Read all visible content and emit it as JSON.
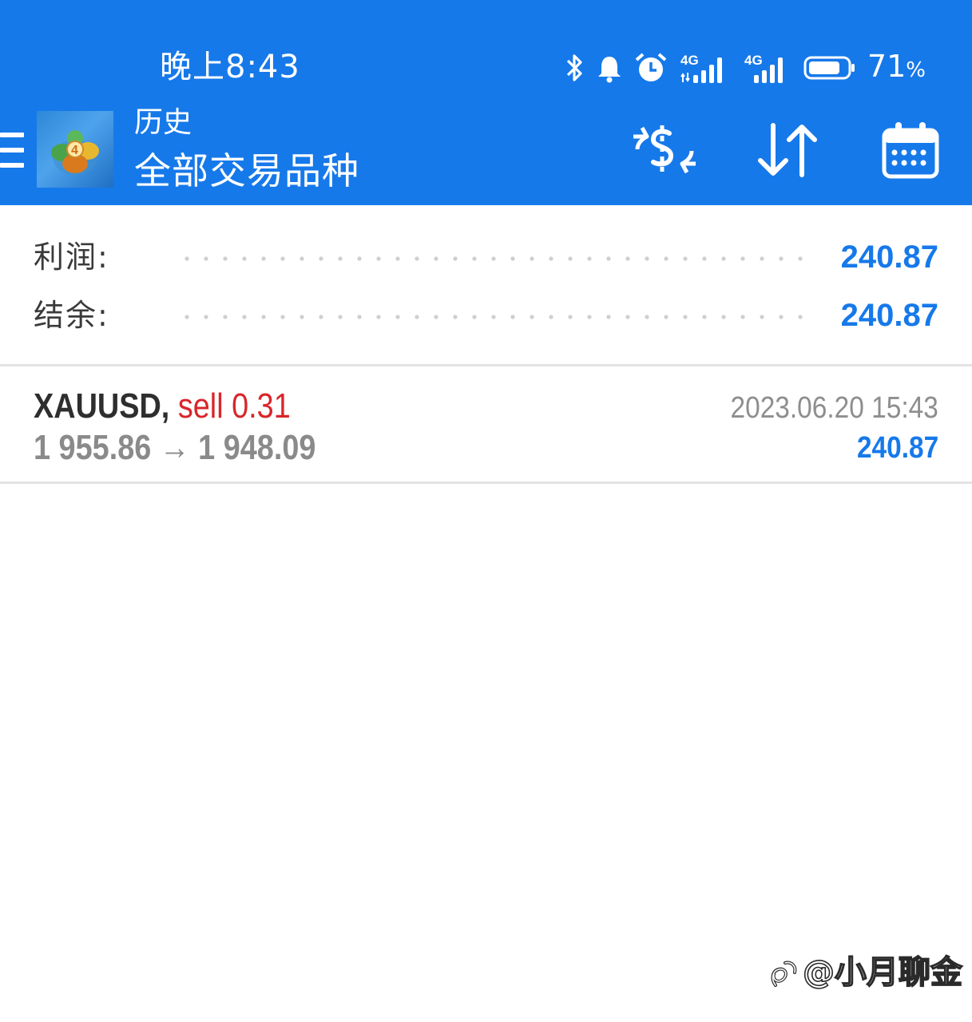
{
  "status_bar": {
    "time": "晚上8:43",
    "network_1": "4G",
    "network_2": "4G",
    "battery_percent": "71",
    "battery_unit": "%"
  },
  "header": {
    "title_small": "历史",
    "title_large": "全部交易品种",
    "logo_badge": "4"
  },
  "summary": {
    "profit_label": "利润:",
    "profit_value": "240.87",
    "balance_label": "结余:",
    "balance_value": "240.87"
  },
  "trades": [
    {
      "symbol": "XAUUSD,",
      "type_volume": "sell 0.31",
      "prices": "1 955.86 → 1 948.09",
      "time": "2023.06.20 15:43",
      "profit": "240.87"
    }
  ],
  "watermark": {
    "text": "@小月聊金"
  },
  "colors": {
    "header_bg": "#1679ea",
    "accent_blue": "#1679ea",
    "sell_red": "#d8262b"
  }
}
